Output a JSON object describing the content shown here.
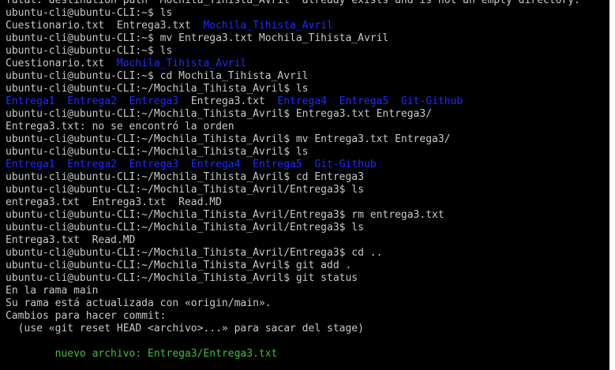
{
  "terminal": {
    "colors": {
      "background": "#000000",
      "text": "#c8c8c8",
      "directory": "#1e2cff",
      "new_file": "#3fbf3f"
    },
    "lines": [
      {
        "segments": [
          {
            "t": "fatal: destination path 'Mochila_Tihista_Avril' already exists and is not an empty directory.",
            "c": "plain"
          }
        ]
      },
      {
        "segments": [
          {
            "t": "ubuntu-cli@ubuntu-CLI:~$ ls",
            "c": "plain"
          }
        ]
      },
      {
        "segments": [
          {
            "t": "Cuestionario.txt  Entrega3.txt  ",
            "c": "plain"
          },
          {
            "t": "Mochila_Tihista_Avril",
            "c": "dir"
          }
        ]
      },
      {
        "segments": [
          {
            "t": "ubuntu-cli@ubuntu-CLI:~$ mv Entrega3.txt Mochila_Tihista_Avril",
            "c": "plain"
          }
        ]
      },
      {
        "segments": [
          {
            "t": "ubuntu-cli@ubuntu-CLI:~$ ls",
            "c": "plain"
          }
        ]
      },
      {
        "segments": [
          {
            "t": "Cuestionario.txt  ",
            "c": "plain"
          },
          {
            "t": "Mochila_Tihista_Avril",
            "c": "dir"
          }
        ]
      },
      {
        "segments": [
          {
            "t": "ubuntu-cli@ubuntu-CLI:~$ cd Mochila_Tihista_Avril",
            "c": "plain"
          }
        ]
      },
      {
        "segments": [
          {
            "t": "ubuntu-cli@ubuntu-CLI:~/Mochila_Tihista_Avril$ ls",
            "c": "plain"
          }
        ]
      },
      {
        "segments": [
          {
            "t": "Entrega1",
            "c": "dir"
          },
          {
            "t": "  ",
            "c": "plain"
          },
          {
            "t": "Entrega2",
            "c": "dir"
          },
          {
            "t": "  ",
            "c": "plain"
          },
          {
            "t": "Entrega3",
            "c": "dir"
          },
          {
            "t": "  Entrega3.txt  ",
            "c": "plain"
          },
          {
            "t": "Entrega4",
            "c": "dir"
          },
          {
            "t": "  ",
            "c": "plain"
          },
          {
            "t": "Entrega5",
            "c": "dir"
          },
          {
            "t": "  ",
            "c": "plain"
          },
          {
            "t": "Git-Github",
            "c": "dir"
          }
        ]
      },
      {
        "segments": [
          {
            "t": "ubuntu-cli@ubuntu-CLI:~/Mochila_Tihista_Avril$ Entrega3.txt Entrega3/",
            "c": "plain"
          }
        ]
      },
      {
        "segments": [
          {
            "t": "Entrega3.txt: no se encontró la orden",
            "c": "plain"
          }
        ]
      },
      {
        "segments": [
          {
            "t": "ubuntu-cli@ubuntu-CLI:~/Mochila_Tihista_Avril$ mv Entrega3.txt Entrega3/",
            "c": "plain"
          }
        ]
      },
      {
        "segments": [
          {
            "t": "ubuntu-cli@ubuntu-CLI:~/Mochila_Tihista_Avril$ ls",
            "c": "plain"
          }
        ]
      },
      {
        "segments": [
          {
            "t": "Entrega1",
            "c": "dir"
          },
          {
            "t": "  ",
            "c": "plain"
          },
          {
            "t": "Entrega2",
            "c": "dir"
          },
          {
            "t": "  ",
            "c": "plain"
          },
          {
            "t": "Entrega3",
            "c": "dir"
          },
          {
            "t": "  ",
            "c": "plain"
          },
          {
            "t": "Entrega4",
            "c": "dir"
          },
          {
            "t": "  ",
            "c": "plain"
          },
          {
            "t": "Entrega5",
            "c": "dir"
          },
          {
            "t": "  ",
            "c": "plain"
          },
          {
            "t": "Git-Github",
            "c": "dir"
          }
        ]
      },
      {
        "segments": [
          {
            "t": "ubuntu-cli@ubuntu-CLI:~/Mochila_Tihista_Avril$ cd Entrega3",
            "c": "plain"
          }
        ]
      },
      {
        "segments": [
          {
            "t": "ubuntu-cli@ubuntu-CLI:~/Mochila_Tihista_Avril/Entrega3$ ls",
            "c": "plain"
          }
        ]
      },
      {
        "segments": [
          {
            "t": "entrega3.txt  Entrega3.txt  Read.MD",
            "c": "plain"
          }
        ]
      },
      {
        "segments": [
          {
            "t": "ubuntu-cli@ubuntu-CLI:~/Mochila_Tihista_Avril/Entrega3$ rm entrega3.txt",
            "c": "plain"
          }
        ]
      },
      {
        "segments": [
          {
            "t": "ubuntu-cli@ubuntu-CLI:~/Mochila_Tihista_Avril/Entrega3$ ls",
            "c": "plain"
          }
        ]
      },
      {
        "segments": [
          {
            "t": "Entrega3.txt  Read.MD",
            "c": "plain"
          }
        ]
      },
      {
        "segments": [
          {
            "t": "ubuntu-cli@ubuntu-CLI:~/Mochila_Tihista_Avril/Entrega3$ cd ..",
            "c": "plain"
          }
        ]
      },
      {
        "segments": [
          {
            "t": "ubuntu-cli@ubuntu-CLI:~/Mochila_Tihista_Avril$ git add .",
            "c": "plain"
          }
        ]
      },
      {
        "segments": [
          {
            "t": "ubuntu-cli@ubuntu-CLI:~/Mochila_Tihista_Avril$ git status",
            "c": "plain"
          }
        ]
      },
      {
        "segments": [
          {
            "t": "En la rama main",
            "c": "plain"
          }
        ]
      },
      {
        "segments": [
          {
            "t": "Su rama está actualizada con «origin/main».",
            "c": "plain"
          }
        ]
      },
      {
        "segments": [
          {
            "t": "Cambios para hacer commit:",
            "c": "plain"
          }
        ]
      },
      {
        "segments": [
          {
            "t": "  (use «git reset HEAD <archivo>...» para sacar del stage)",
            "c": "plain"
          }
        ]
      },
      {
        "segments": [
          {
            "t": "",
            "c": "plain"
          }
        ]
      },
      {
        "segments": [
          {
            "t": "        nuevo archivo: Entrega3/Entrega3.txt",
            "c": "green"
          }
        ]
      }
    ]
  }
}
